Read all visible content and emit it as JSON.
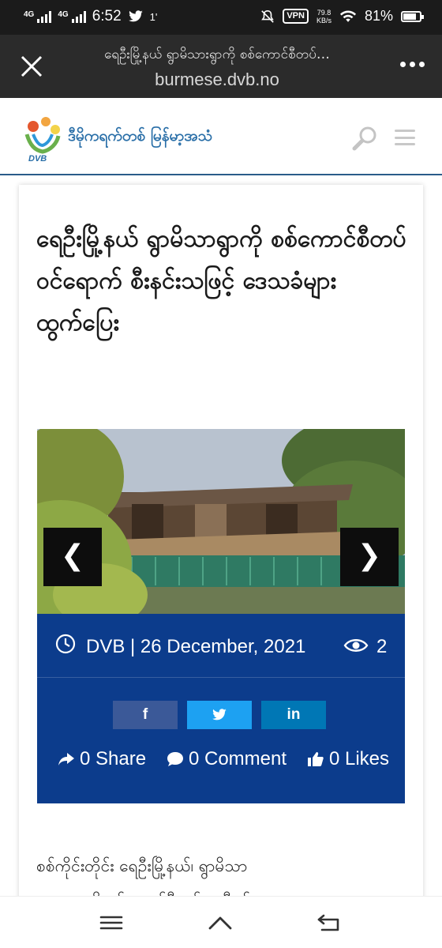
{
  "status_bar": {
    "time": "6:52",
    "network_1": "4G",
    "network_2": "4G",
    "extra": "1'",
    "vpn": "VPN",
    "speed_value": "79.8",
    "speed_unit": "KB/s",
    "battery": "81%",
    "battery_level": 0.81
  },
  "browser": {
    "page_title": "ရေဦးမြို့နယ် ရွာမိသားရွာကို စစ်ကောင်စီတပ်…",
    "host": "burmese.dvb.no"
  },
  "site": {
    "name": "ဒီမိုကရက်တစ် မြန်မာ့အသံ",
    "logo_text": "DVB"
  },
  "article": {
    "headline": "ရေဦးမြို့နယ် ရွာမိသာရွာကို စစ်ကောင်စီတပ် ဝင်ရောက် စီးနင်းသဖြင့် ဒေသခံများ ထွက်ပြေး",
    "prev_label": "❮",
    "next_label": "❯",
    "meta": "DVB | 26 December, 2021",
    "views": "2",
    "facebook_label": "f",
    "twitter_label": "🐦",
    "linkedin_label": "in",
    "share_label": "0 Share",
    "comment_label": "0 Comment",
    "likes_label": "0 Likes",
    "body_line_1": "စစ်ကိုင်းတိုင်း ရေဦးမြို့နယ်၊ ရွာမိသာ",
    "body_line_2": "ကျေးရွာကို စစ်ကောင်စီတပ်က ဒီဇင်ဘာ"
  },
  "colors": {
    "status_bg": "#1b1b1b",
    "url_bg": "#2b2b2b",
    "brand_blue": "#2a6fa8",
    "meta_panel": "#0c3c8c",
    "facebook": "#3b5998",
    "twitter": "#1da1f2",
    "linkedin": "#0077b5"
  },
  "icons": [
    "signal-icon",
    "twitter-bird-icon",
    "mute-icon",
    "wifi-icon",
    "battery-icon",
    "close-icon",
    "more-icon",
    "search-icon",
    "menu-icon",
    "clock-icon",
    "eye-icon",
    "share-icon",
    "comment-icon",
    "thumbs-up-icon",
    "recent-apps-icon",
    "home-icon",
    "back-icon"
  ]
}
